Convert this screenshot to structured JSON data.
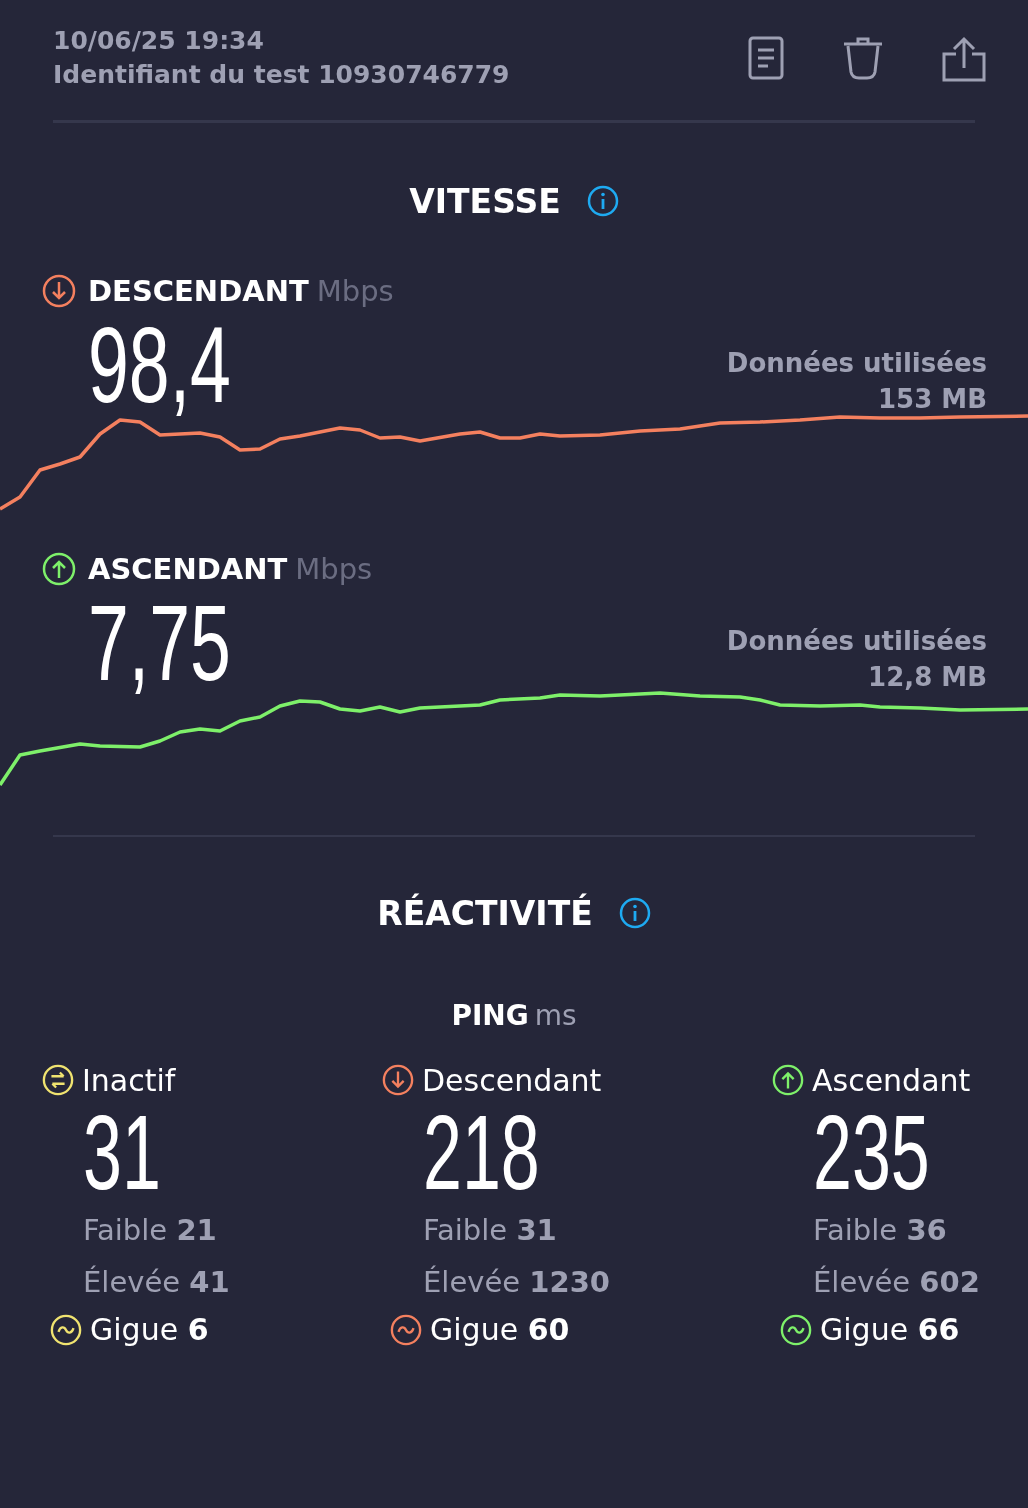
{
  "header": {
    "datetime": "10/06/25 19:34",
    "test_id": "Identifiant du test 10930746779"
  },
  "speed": {
    "title": "VITESSE",
    "tests": [
      {
        "kind": "download",
        "label": "DESCENDANT",
        "unit": "Mbps",
        "value": "98,4",
        "data_label": "Données utilisées",
        "data_value": "153 MB"
      },
      {
        "kind": "upload",
        "label": "ASCENDANT",
        "unit": "Mbps",
        "value": "7,75",
        "data_label": "Données utilisées",
        "data_value": "12,8 MB"
      }
    ]
  },
  "responsiveness": {
    "title": "RÉACTIVITÉ",
    "ping_label": "PING",
    "ping_unit": "ms",
    "columns": [
      {
        "kind": "idle",
        "label": "Inactif",
        "value": "31",
        "low_label": "Faible",
        "low": "21",
        "high_label": "Élevée",
        "high": "41",
        "jitter_label": "Gigue",
        "jitter": "6"
      },
      {
        "kind": "download",
        "label": "Descendant",
        "value": "218",
        "low_label": "Faible",
        "low": "31",
        "high_label": "Élevée",
        "high": "1230",
        "jitter_label": "Gigue",
        "jitter": "60"
      },
      {
        "kind": "upload",
        "label": "Ascendant",
        "value": "235",
        "low_label": "Faible",
        "low": "36",
        "high_label": "Élevée",
        "high": "602",
        "jitter_label": "Gigue",
        "jitter": "66"
      }
    ]
  }
}
